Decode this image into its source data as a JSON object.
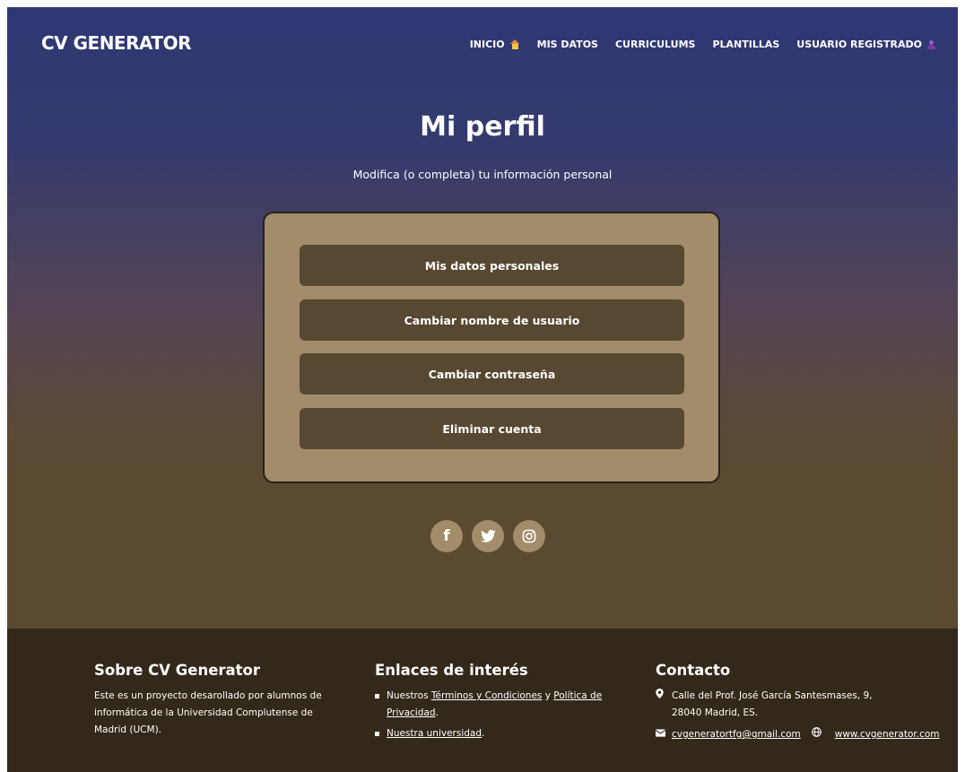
{
  "header": {
    "brand": "CV GENERATOR",
    "nav": [
      {
        "label": "INICIO",
        "icon": "house-icon"
      },
      {
        "label": "MIS DATOS"
      },
      {
        "label": "CURRICULUMS"
      },
      {
        "label": "PLANTILLAS"
      },
      {
        "label": "USUARIO REGISTRADO",
        "icon": "user-icon"
      }
    ]
  },
  "main": {
    "title": "Mi perfil",
    "subtitle": "Modifica (o completa) tu información personal",
    "buttons": [
      "Mis datos personales",
      "Cambiar nombre de usuario",
      "Cambiar contraseña",
      "Eliminar cuenta"
    ],
    "socials": [
      {
        "name": "facebook-icon",
        "glyph": "f"
      },
      {
        "name": "twitter-icon",
        "glyph": "🐦"
      },
      {
        "name": "instagram-icon",
        "glyph": "◎"
      }
    ]
  },
  "footer": {
    "about": {
      "title": "Sobre CV Generator",
      "text": "Este es un proyecto desarollado por alumnos de informática de la Universidad Complutense de Madrid (UCM)."
    },
    "links": {
      "title": "Enlaces de interés",
      "item1_prefix": "Nuestros ",
      "item1_link1": "Términos y Condiciones",
      "item1_mid": " y ",
      "item1_link2": "Política de Privacidad",
      "item1_suffix": ".",
      "item2_link": "Nuestra universidad",
      "item2_suffix": "."
    },
    "contact": {
      "title": "Contacto",
      "address_line1": "Calle del Prof. José García Santesmases, 9,",
      "address_line2": "28040 Madrid, ES.",
      "email": "cvgeneratortfg@gmail.com",
      "web": "www.cvgenerator.com"
    }
  },
  "colors": {
    "gradient_top": "#2e3874",
    "gradient_bottom": "#594a30",
    "card": "#a28c6a",
    "button": "#574831",
    "footer": "#33291b"
  }
}
